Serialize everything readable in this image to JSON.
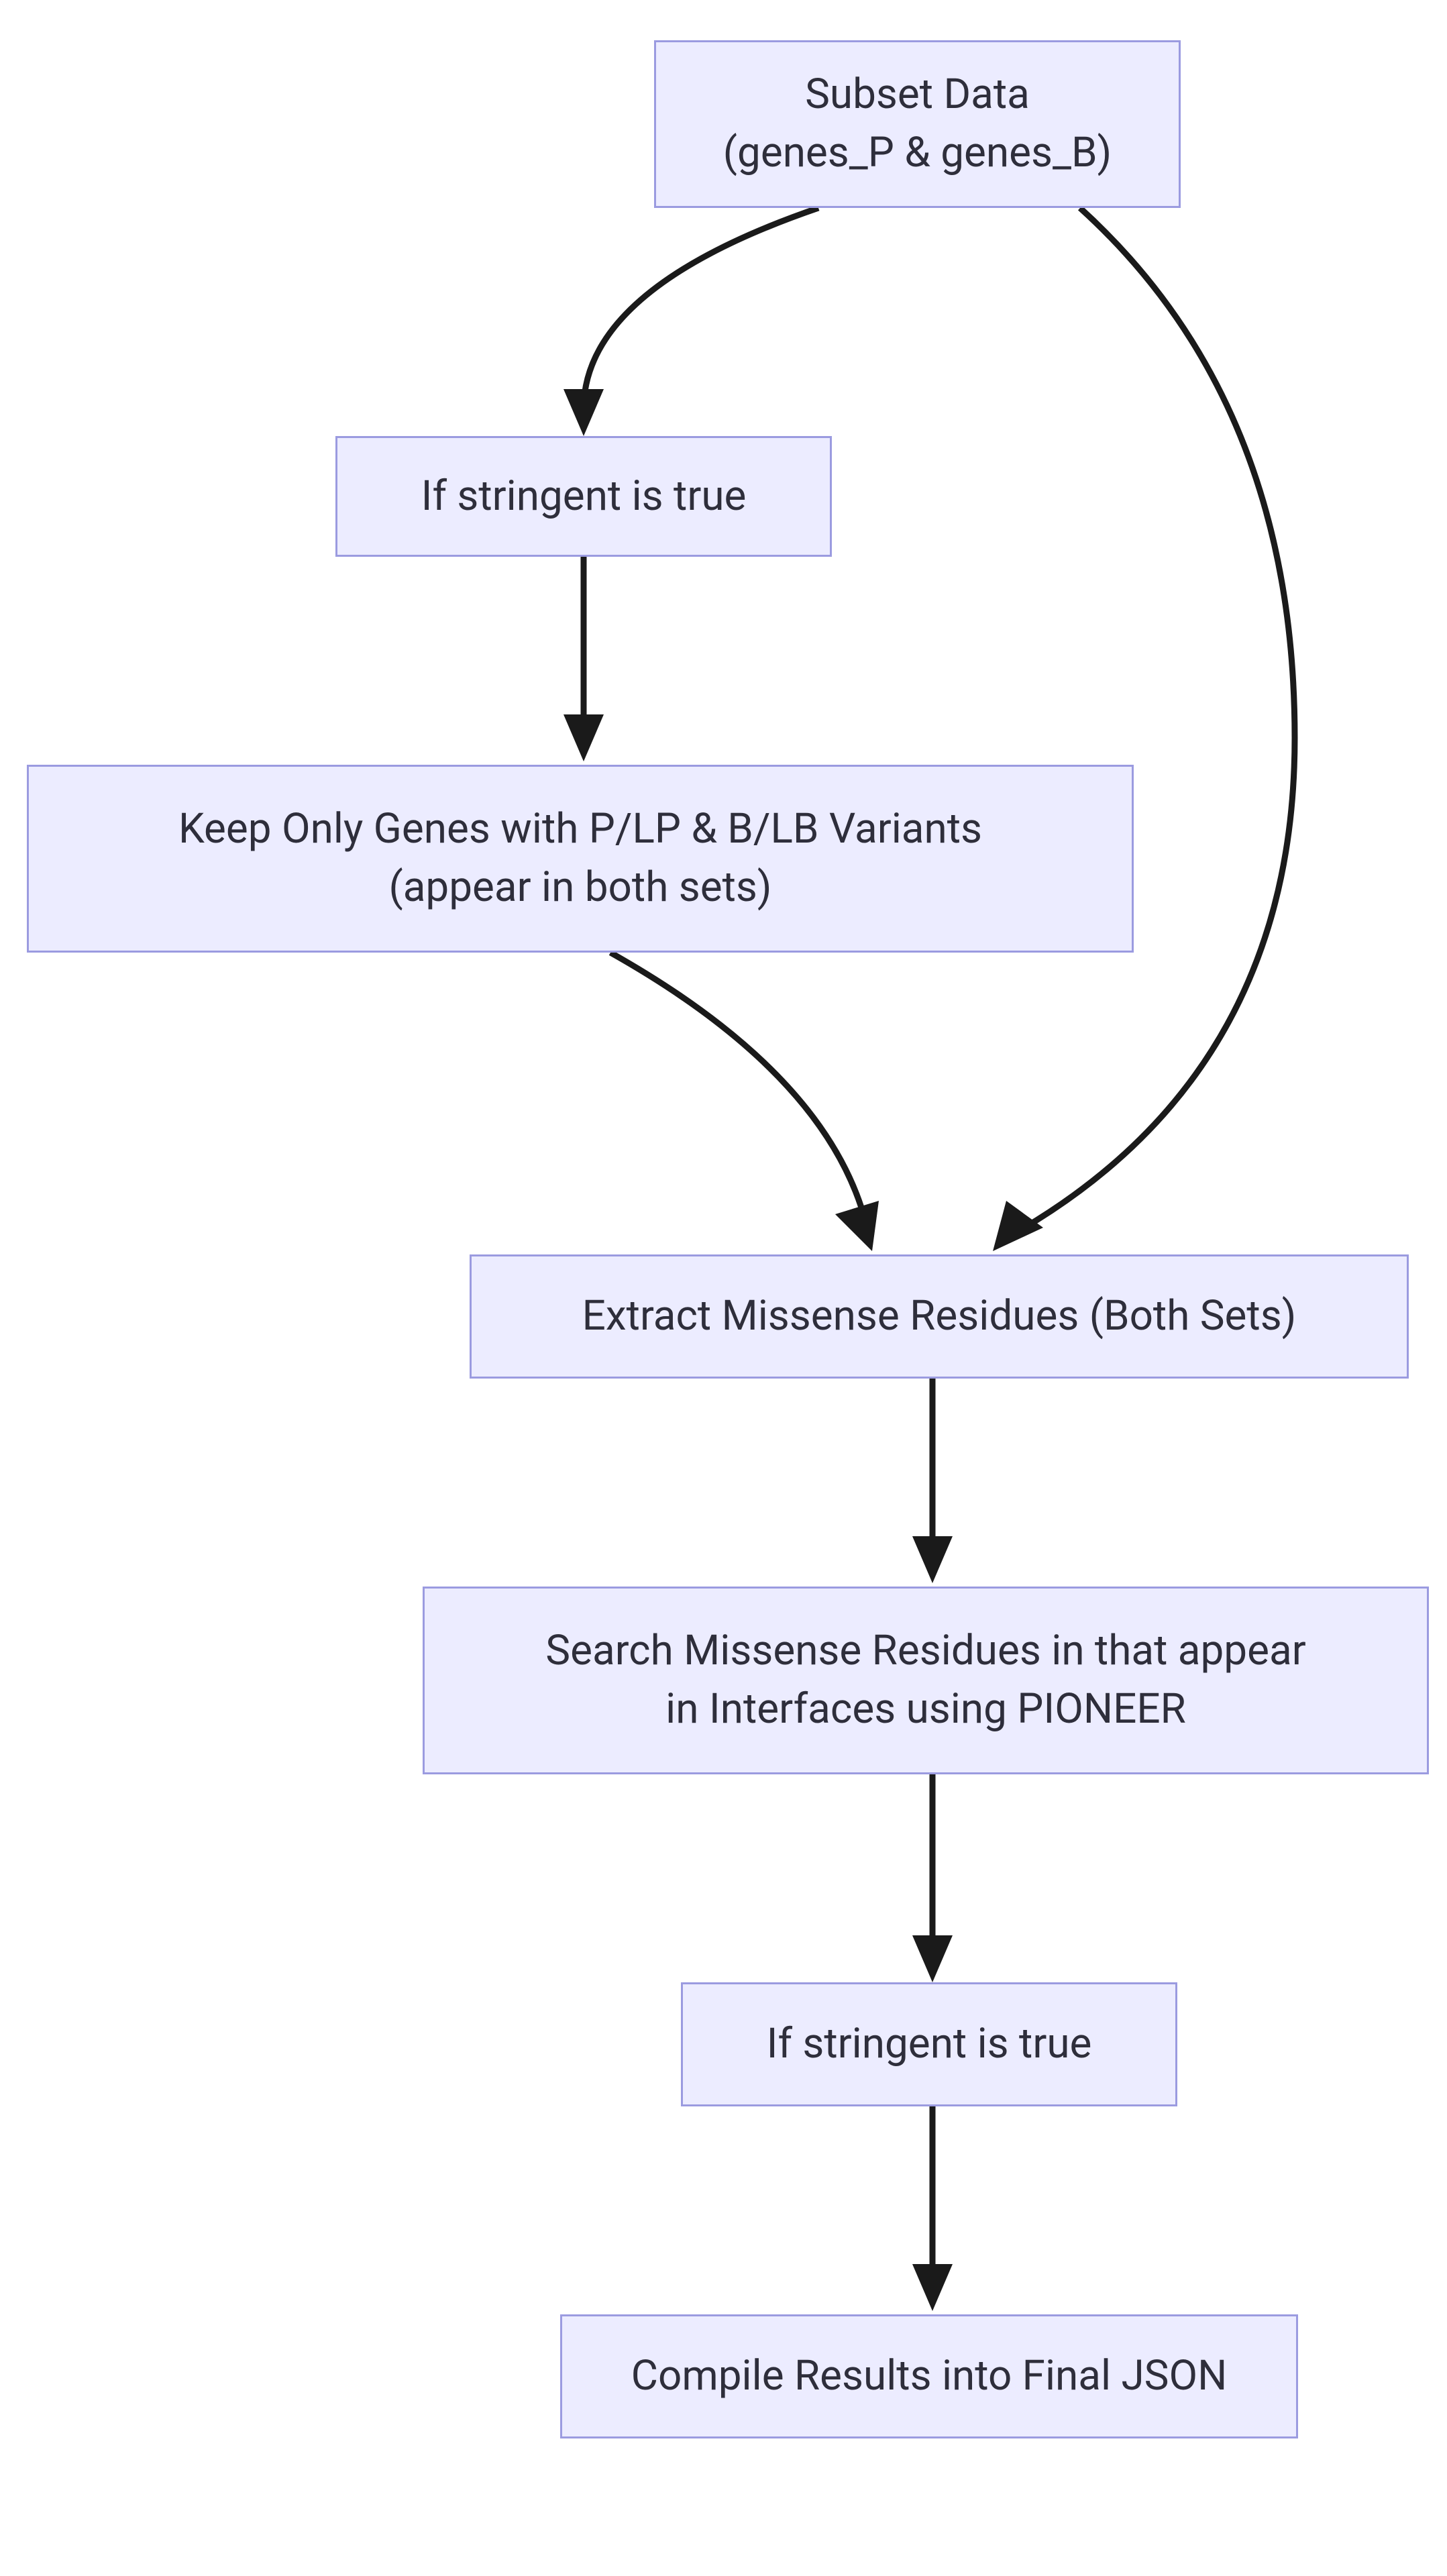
{
  "chart_data": {
    "type": "flowchart",
    "nodes": [
      {
        "id": "subset",
        "label": "Subset Data\n(genes_P & genes_B)"
      },
      {
        "id": "stringent1",
        "label": "If stringent is true"
      },
      {
        "id": "keep",
        "label": "Keep Only Genes with P/LP & B/LB Variants\n(appear in both sets)"
      },
      {
        "id": "extract",
        "label": "Extract Missense Residues (Both Sets)"
      },
      {
        "id": "search",
        "label": "Search Missense Residues in that appear\nin Interfaces using PIONEER"
      },
      {
        "id": "stringent2",
        "label": "If stringent is true"
      },
      {
        "id": "compile",
        "label": "Compile Results into Final JSON"
      }
    ],
    "edges": [
      {
        "from": "subset",
        "to": "stringent1"
      },
      {
        "from": "subset",
        "to": "extract"
      },
      {
        "from": "stringent1",
        "to": "keep"
      },
      {
        "from": "keep",
        "to": "extract"
      },
      {
        "from": "extract",
        "to": "search"
      },
      {
        "from": "search",
        "to": "stringent2"
      },
      {
        "from": "stringent2",
        "to": "compile"
      }
    ]
  },
  "nodes": {
    "subset": {
      "line1": "Subset Data",
      "line2": "(genes_P & genes_B)"
    },
    "stringent1": {
      "label": "If stringent is true"
    },
    "keep": {
      "line1": "Keep Only Genes with P/LP & B/LB Variants",
      "line2": "(appear in both sets)"
    },
    "extract": {
      "label": "Extract Missense Residues (Both Sets)"
    },
    "search": {
      "line1": "Search Missense Residues in that appear",
      "line2": "in Interfaces using PIONEER"
    },
    "stringent2": {
      "label": "If stringent is true"
    },
    "compile": {
      "label": "Compile Results into Final JSON"
    }
  }
}
